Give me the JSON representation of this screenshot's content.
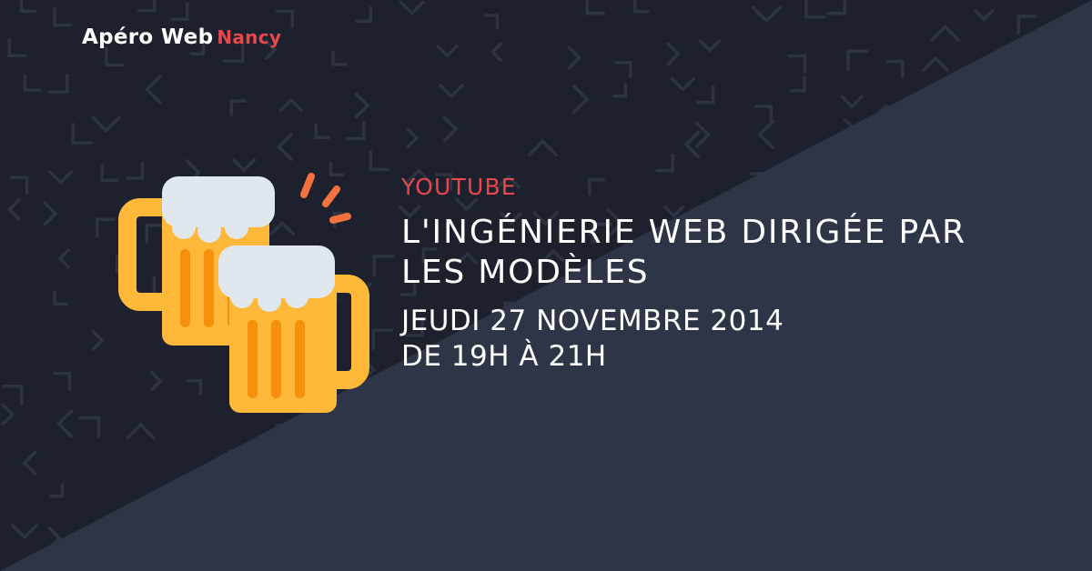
{
  "brand": {
    "name": "Apéro Web",
    "city": "Nancy"
  },
  "event": {
    "category": "YOUTUBE",
    "title_line1": "L'INGÉNIERIE WEB DIRIGÉE PAR",
    "title_line2": "LES MODÈLES",
    "date": "JEUDI 27 NOVEMBRE 2014",
    "time": "DE 19H À 21H"
  },
  "colors": {
    "background_dark": "#1c212d",
    "background_light": "#2e3546",
    "accent": "#e8474c",
    "beer": "#ffb83a",
    "foam": "#e1e8ed",
    "splash": "#f4713d"
  },
  "icons": {
    "illustration": "clinking-beer-mugs-icon"
  }
}
